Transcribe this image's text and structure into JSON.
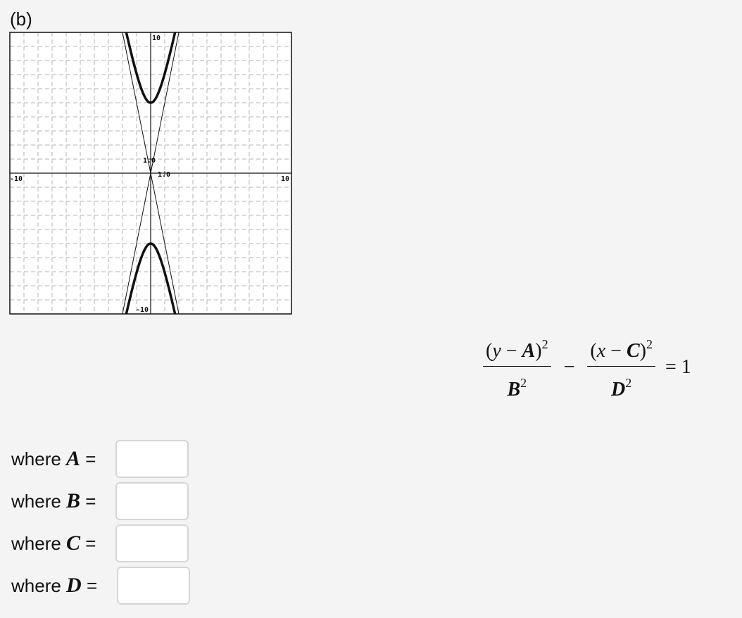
{
  "part_label": "(b)",
  "chart_data": {
    "type": "line",
    "title": "",
    "xlabel": "",
    "ylabel": "",
    "xlim": [
      -10,
      10
    ],
    "ylim": [
      -10,
      10
    ],
    "grid": true,
    "grid_step": 1,
    "tick_labels": {
      "x_min": "-10",
      "x_max": "10",
      "y_max": "10",
      "y_min": "-10",
      "x_unit": "1.0",
      "y_unit": "1.0"
    },
    "curve": {
      "name": "hyperbola",
      "equation": "y^2/25 - x^2/1 = 1",
      "center": [
        0,
        0
      ],
      "vertices": [
        [
          0,
          5
        ],
        [
          0,
          -5
        ]
      ],
      "a_vertical": 5,
      "b_horizontal": 1
    },
    "asymptotes": [
      {
        "name": "asymptote-positive",
        "slope": 5,
        "intercept": 0
      },
      {
        "name": "asymptote-negative",
        "slope": -5,
        "intercept": 0
      }
    ]
  },
  "equation": {
    "num1_open": "(",
    "num1_var": "y",
    "num1_minus": " − ",
    "num1_const": "A",
    "num1_close": ")",
    "num1_exp": "2",
    "den1_var": "B",
    "den1_exp": "2",
    "operator": "−",
    "num2_open": "(",
    "num2_var": "x",
    "num2_minus": " − ",
    "num2_const": "C",
    "num2_close": ")",
    "num2_exp": "2",
    "den2_var": "D",
    "den2_exp": "2",
    "equals": "= 1"
  },
  "answers": [
    {
      "prefix": "where ",
      "var": "A",
      "suffix": " =",
      "value": "",
      "placeholder": ""
    },
    {
      "prefix": "where ",
      "var": "B",
      "suffix": " =",
      "value": "",
      "placeholder": ""
    },
    {
      "prefix": "where ",
      "var": "C",
      "suffix": " =",
      "value": "",
      "placeholder": ""
    },
    {
      "prefix": "where ",
      "var": "D",
      "suffix": " =",
      "value": "",
      "placeholder": ""
    }
  ]
}
